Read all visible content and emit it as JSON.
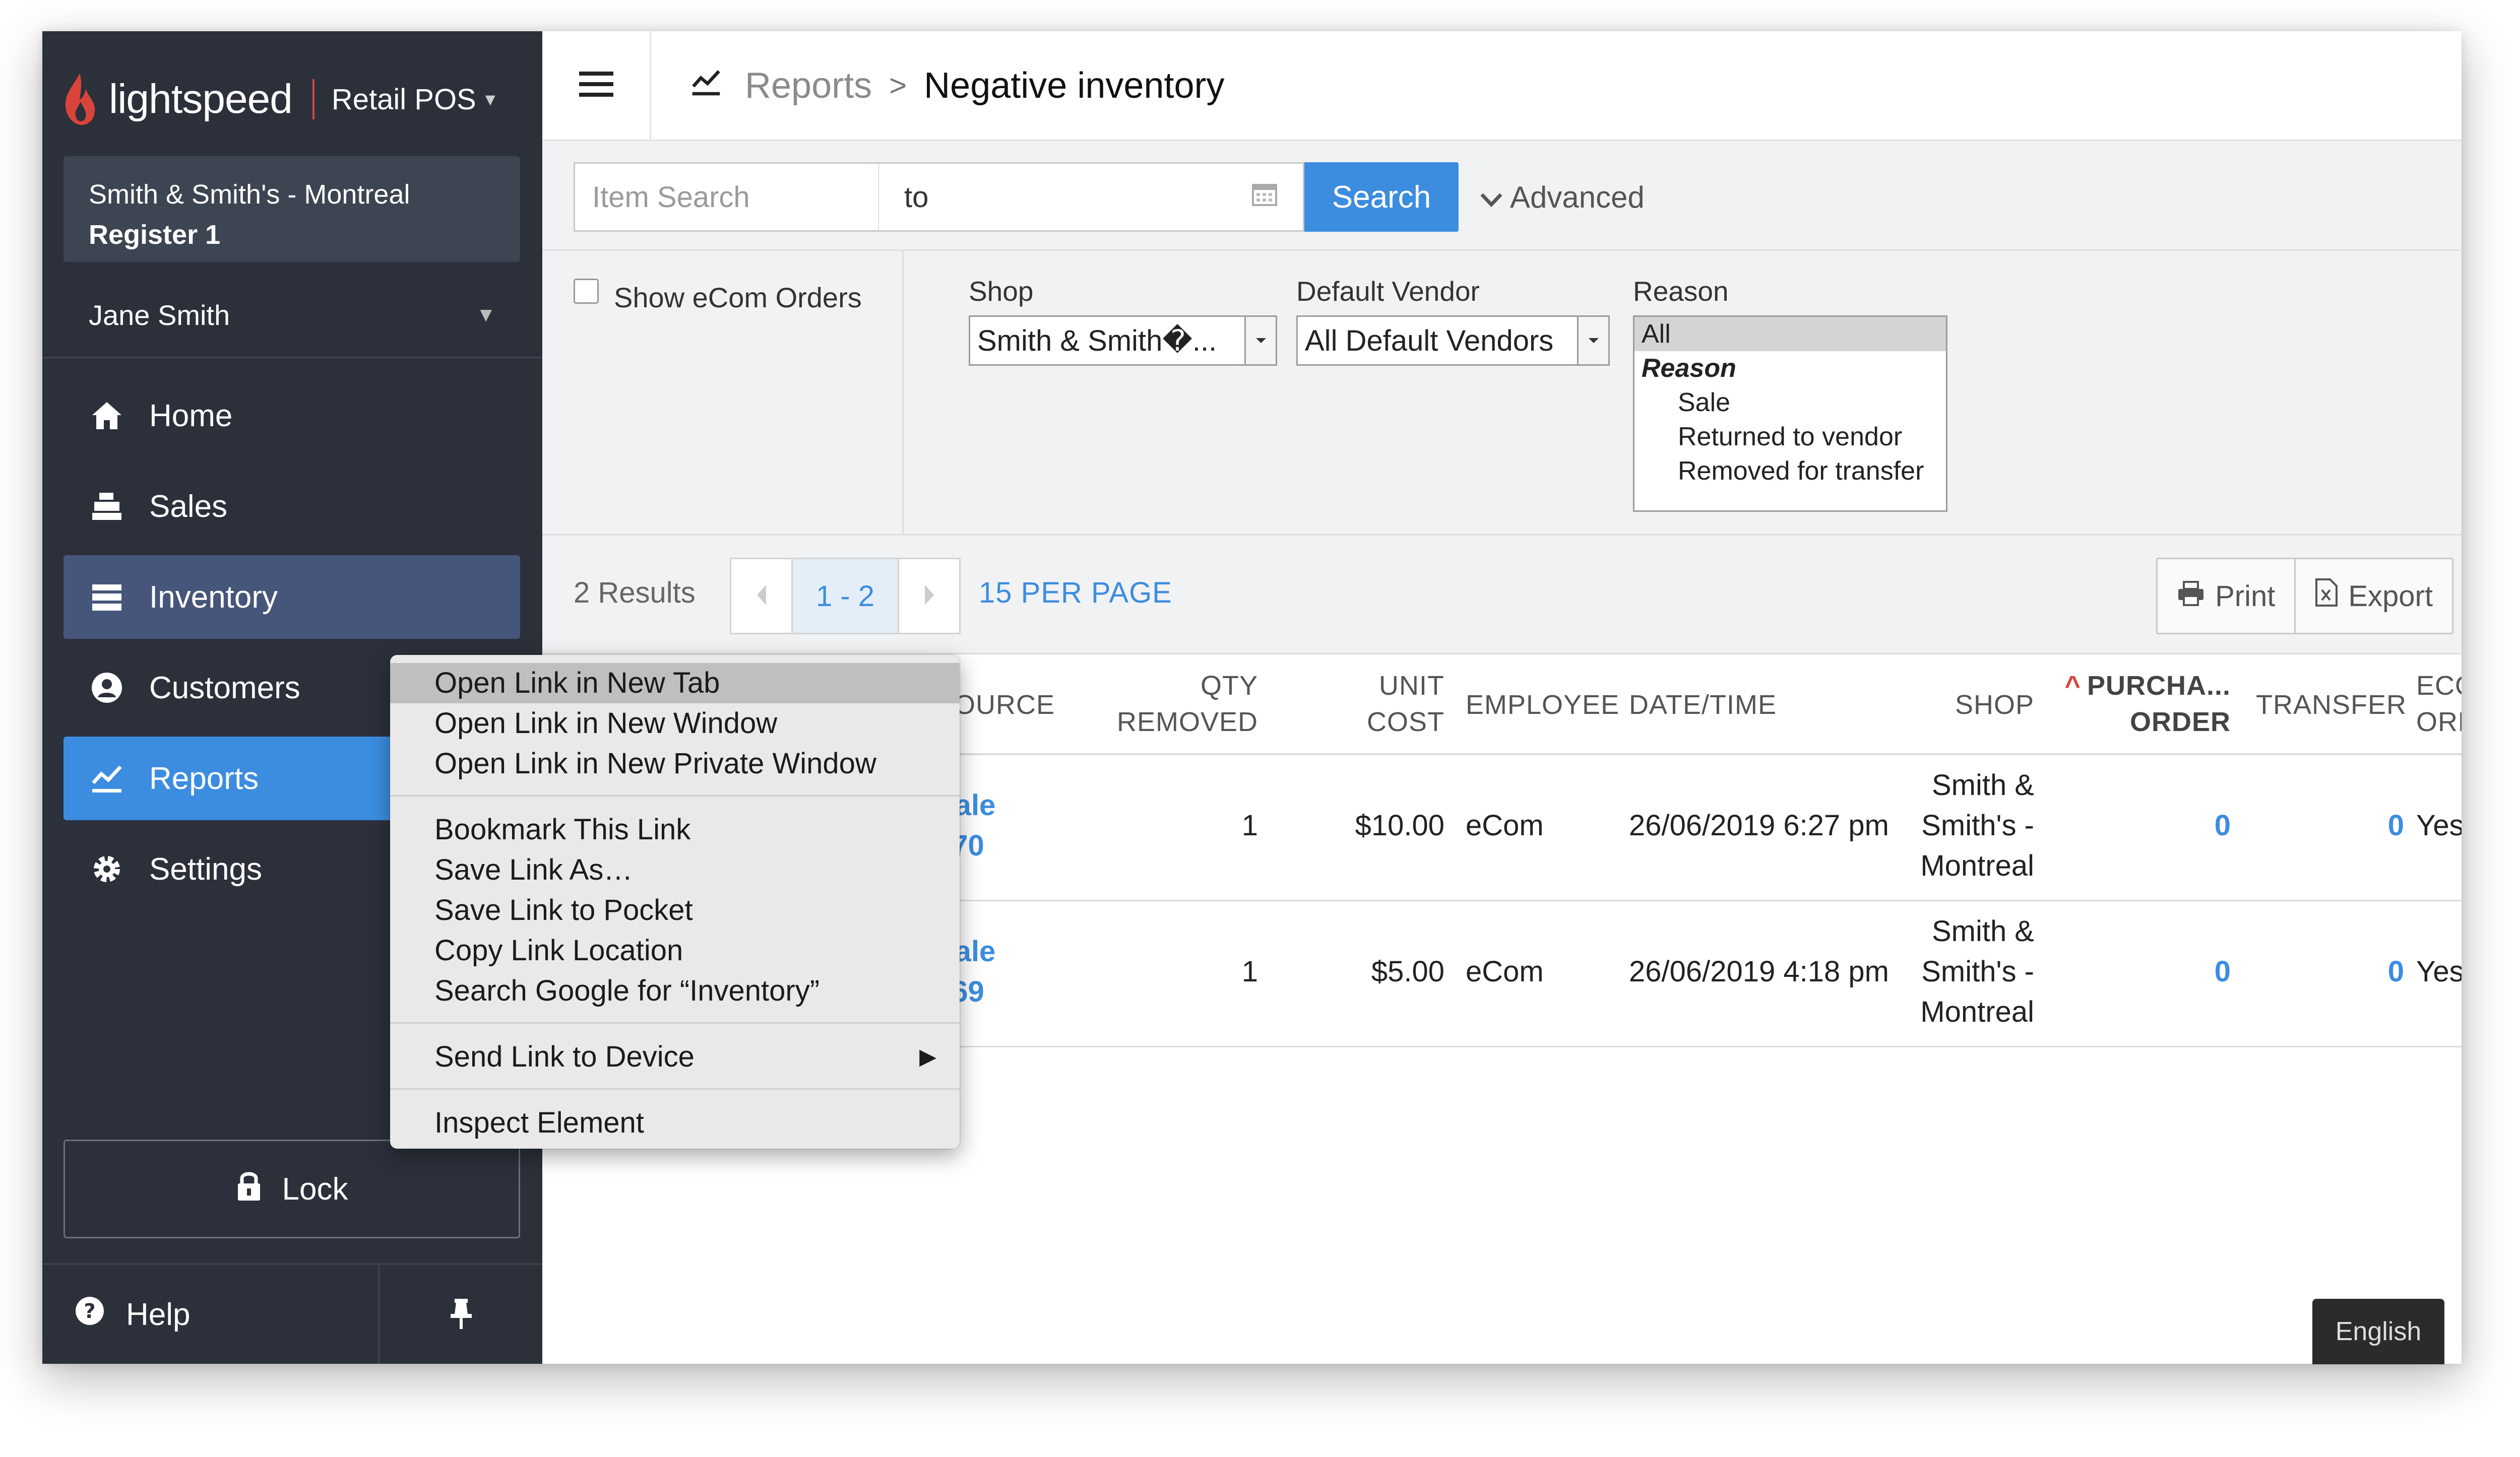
{
  "brand": {
    "name": "lightspeed",
    "product": "Retail POS",
    "accent": "#d9443a"
  },
  "register": {
    "location": "Smith & Smith's - Montreal",
    "register": "Register 1"
  },
  "user": {
    "name": "Jane Smith"
  },
  "nav": {
    "items": [
      {
        "label": "Home",
        "icon": "home-icon"
      },
      {
        "label": "Sales",
        "icon": "register-icon"
      },
      {
        "label": "Inventory",
        "icon": "inventory-icon"
      },
      {
        "label": "Customers",
        "icon": "user-icon"
      },
      {
        "label": "Reports",
        "icon": "chart-icon"
      },
      {
        "label": "Settings",
        "icon": "gear-icon"
      }
    ],
    "active": "Reports",
    "hovered": "Inventory"
  },
  "lock": {
    "label": "Lock"
  },
  "help": {
    "label": "Help"
  },
  "breadcrumb": {
    "parent": "Reports",
    "current": "Negative inventory"
  },
  "search": {
    "item_placeholder": "Item Search",
    "item_value": "",
    "date_to": "to",
    "button": "Search",
    "advanced": "Advanced"
  },
  "filters": {
    "show_ecom_label": "Show eCom Orders",
    "show_ecom_checked": false,
    "shop_label": "Shop",
    "shop_value": "Smith & Smith�...",
    "vendor_label": "Default Vendor",
    "vendor_value": "All Default Vendors",
    "reason_label": "Reason",
    "reason_options": {
      "selected": "All",
      "group": "Reason",
      "options": [
        "Sale",
        "Returned to vendor",
        "Removed for transfer"
      ]
    }
  },
  "results": {
    "count": "2 Results",
    "range": "1 - 2",
    "per_page": "15 PER PAGE",
    "print": "Print",
    "export": "Export"
  },
  "table": {
    "headers": {
      "source": "SOURCE",
      "qty_1": "QTY",
      "qty_2": "REMOVED",
      "cost_1": "UNIT",
      "cost_2": "COST",
      "employee": "EMPLOYEE",
      "datetime": "DATE/TIME",
      "shop": "SHOP",
      "po_1": "PURCHA...",
      "po_2": "ORDER",
      "transfer": "TRANSFER",
      "ecom_1": "ECOM",
      "ecom_2": "ORDER"
    },
    "rows": [
      {
        "source_1": "Sale",
        "source_2": "#70",
        "qty": "1",
        "cost": "$10.00",
        "employee": "eCom",
        "datetime": "26/06/2019 6:27 pm",
        "shop_1": "Smith &",
        "shop_2": "Smith's -",
        "shop_3": "Montreal",
        "po": "0",
        "transfer": "0",
        "ecom": "Yes"
      },
      {
        "source_1": "Sale",
        "source_2": "#69",
        "qty": "1",
        "cost": "$5.00",
        "employee": "eCom",
        "datetime": "26/06/2019 4:18 pm",
        "shop_1": "Smith &",
        "shop_2": "Smith's -",
        "shop_3": "Montreal",
        "po": "0",
        "transfer": "0",
        "ecom": "Yes"
      }
    ]
  },
  "context_menu": {
    "items": [
      "Open Link in New Tab",
      "Open Link in New Window",
      "Open Link in New Private Window",
      "Bookmark This Link",
      "Save Link As…",
      "Save Link to Pocket",
      "Copy Link Location",
      "Search Google for “Inventory”",
      "Send Link to Device",
      "Inspect Element"
    ],
    "highlighted": "Open Link in New Tab"
  },
  "language": {
    "label": "English"
  },
  "colors": {
    "sidebar": "#2b303b",
    "accent_blue": "#3c8de0",
    "panel": "#f1f2f4"
  }
}
